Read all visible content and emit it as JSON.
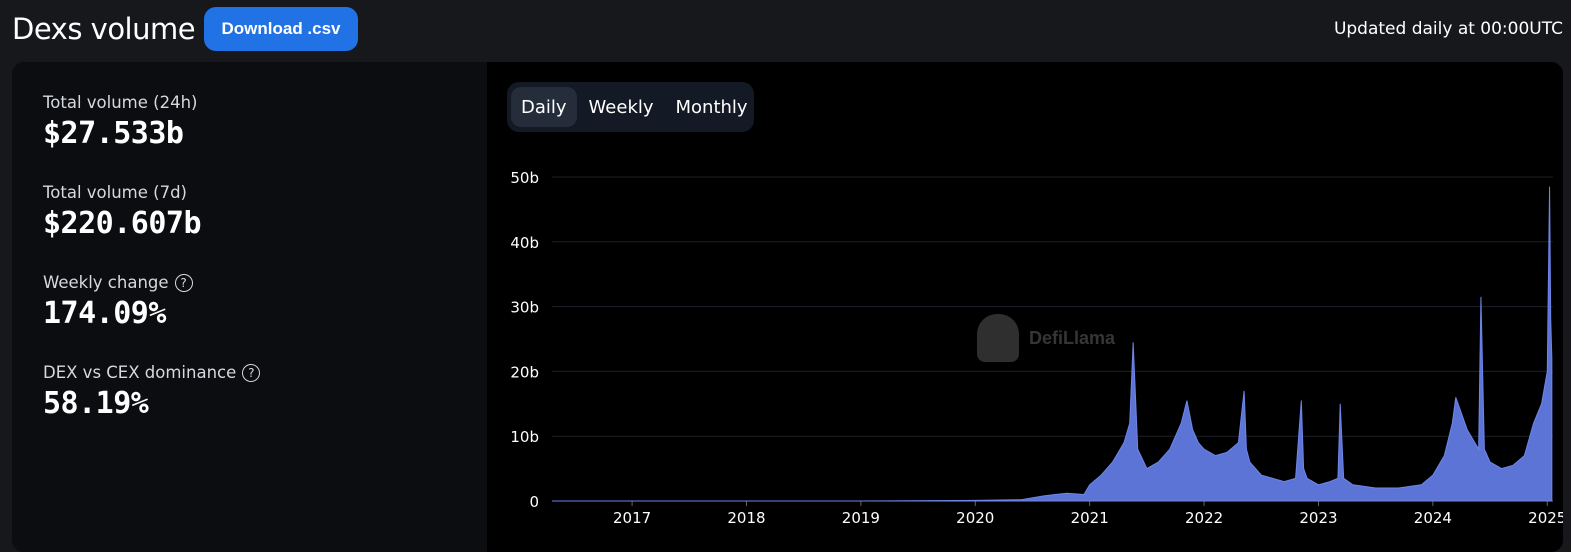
{
  "header": {
    "title": "Dexs volume",
    "download_label": "Download .csv",
    "updated_text": "Updated daily at 00:00UTC"
  },
  "stats": [
    {
      "label": "Total volume (24h)",
      "value": "$27.533b",
      "help": false
    },
    {
      "label": "Total volume (7d)",
      "value": "$220.607b",
      "help": false
    },
    {
      "label": "Weekly change",
      "value": "174.09%",
      "help": true
    },
    {
      "label": "DEX vs CEX dominance",
      "value": "58.19%",
      "help": true
    }
  ],
  "tabs": [
    {
      "label": "Daily",
      "active": true
    },
    {
      "label": "Weekly",
      "active": false
    },
    {
      "label": "Monthly",
      "active": false
    }
  ],
  "watermark": "DefiLlama",
  "colors": {
    "accent": "#2172e5",
    "series": "#5b74d6",
    "background": "#000000"
  },
  "chart_data": {
    "type": "area",
    "title": "",
    "xlabel": "",
    "ylabel": "",
    "ylim": [
      0,
      50
    ],
    "y_ticks": [
      "0",
      "10b",
      "20b",
      "30b",
      "40b",
      "50b"
    ],
    "x_ticks": [
      "2017",
      "2018",
      "2019",
      "2020",
      "2021",
      "2022",
      "2023",
      "2024",
      "2025"
    ],
    "x_range": [
      2016.3,
      2025.05
    ],
    "series": [
      {
        "x": [
          2016.3,
          2017.0,
          2018.0,
          2019.0,
          2020.0,
          2020.4,
          2020.6,
          2020.7,
          2020.8,
          2020.95,
          2021.0,
          2021.1,
          2021.2,
          2021.3,
          2021.35,
          2021.38,
          2021.42,
          2021.5,
          2021.6,
          2021.7,
          2021.8,
          2021.85,
          2021.9,
          2021.95,
          2022.0,
          2022.1,
          2022.2,
          2022.3,
          2022.35,
          2022.37,
          2022.4,
          2022.5,
          2022.6,
          2022.7,
          2022.8,
          2022.85,
          2022.87,
          2022.9,
          2023.0,
          2023.1,
          2023.17,
          2023.19,
          2023.22,
          2023.3,
          2023.5,
          2023.7,
          2023.9,
          2024.0,
          2024.1,
          2024.17,
          2024.2,
          2024.3,
          2024.4,
          2024.42,
          2024.45,
          2024.5,
          2024.6,
          2024.7,
          2024.8,
          2024.88,
          2024.95,
          2025.0,
          2025.02,
          2025.03,
          2025.04
        ],
        "values": [
          0,
          0,
          0,
          0,
          0.1,
          0.2,
          0.8,
          1.0,
          1.2,
          1.0,
          2.5,
          4.0,
          6.0,
          9.0,
          12.0,
          24.5,
          8.0,
          5.0,
          6.0,
          8.0,
          12.0,
          15.5,
          11.0,
          9.0,
          8.0,
          7.0,
          7.5,
          9.0,
          17.0,
          8.0,
          6.0,
          4.0,
          3.5,
          3.0,
          3.5,
          15.5,
          5.0,
          3.5,
          2.5,
          3.0,
          3.5,
          15.0,
          3.5,
          2.5,
          2.0,
          2.0,
          2.5,
          4.0,
          7.0,
          12.0,
          16.0,
          11.0,
          8.0,
          31.5,
          8.0,
          6.0,
          5.0,
          5.5,
          7.0,
          12.0,
          15.0,
          20.0,
          48.5,
          28.0,
          22.0
        ]
      }
    ]
  }
}
